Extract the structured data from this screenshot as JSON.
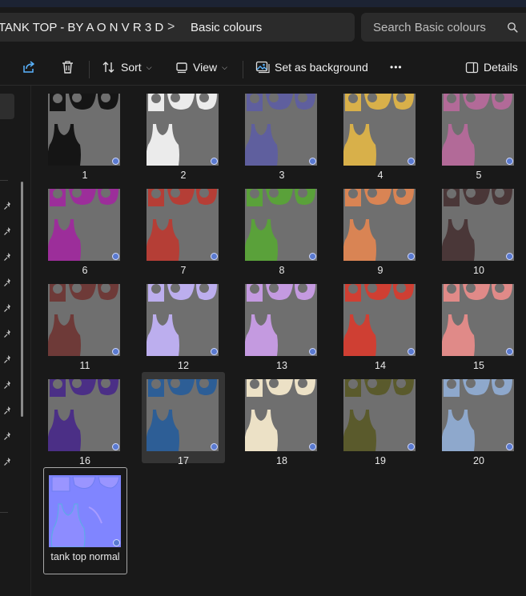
{
  "address": {
    "path_parent": "TANK TOP - BY A O N V R 3 D",
    "separator": ">",
    "current": "Basic colours"
  },
  "search": {
    "placeholder": "Search Basic colours",
    "icon": "search-icon"
  },
  "toolbar": {
    "sort_label": "Sort",
    "view_label": "View",
    "background_label": "Set as background",
    "more_label": "•••",
    "details_label": "Details"
  },
  "files": [
    {
      "name": "1",
      "color": "#151515"
    },
    {
      "name": "2",
      "color": "#ebebeb"
    },
    {
      "name": "3",
      "color": "#5f5f9e"
    },
    {
      "name": "4",
      "color": "#d8b04a"
    },
    {
      "name": "5",
      "color": "#b26a98"
    },
    {
      "name": "6",
      "color": "#9c2e9a"
    },
    {
      "name": "7",
      "color": "#b53e36"
    },
    {
      "name": "8",
      "color": "#5aa13a"
    },
    {
      "name": "9",
      "color": "#d98454"
    },
    {
      "name": "10",
      "color": "#4a3738"
    },
    {
      "name": "11",
      "color": "#6e3a38"
    },
    {
      "name": "12",
      "color": "#bcaeee"
    },
    {
      "name": "13",
      "color": "#c49ae0"
    },
    {
      "name": "14",
      "color": "#cf3f33"
    },
    {
      "name": "15",
      "color": "#e08a88"
    },
    {
      "name": "16",
      "color": "#4b2f86"
    },
    {
      "name": "17",
      "color": "#2d5e96",
      "selected": true
    },
    {
      "name": "18",
      "color": "#ece1c6"
    },
    {
      "name": "19",
      "color": "#5a5a2c"
    },
    {
      "name": "20",
      "color": "#8ea8cc"
    },
    {
      "name": "tank top normal",
      "color": "#7f84ff",
      "normal_map": true,
      "focused": true
    }
  ]
}
